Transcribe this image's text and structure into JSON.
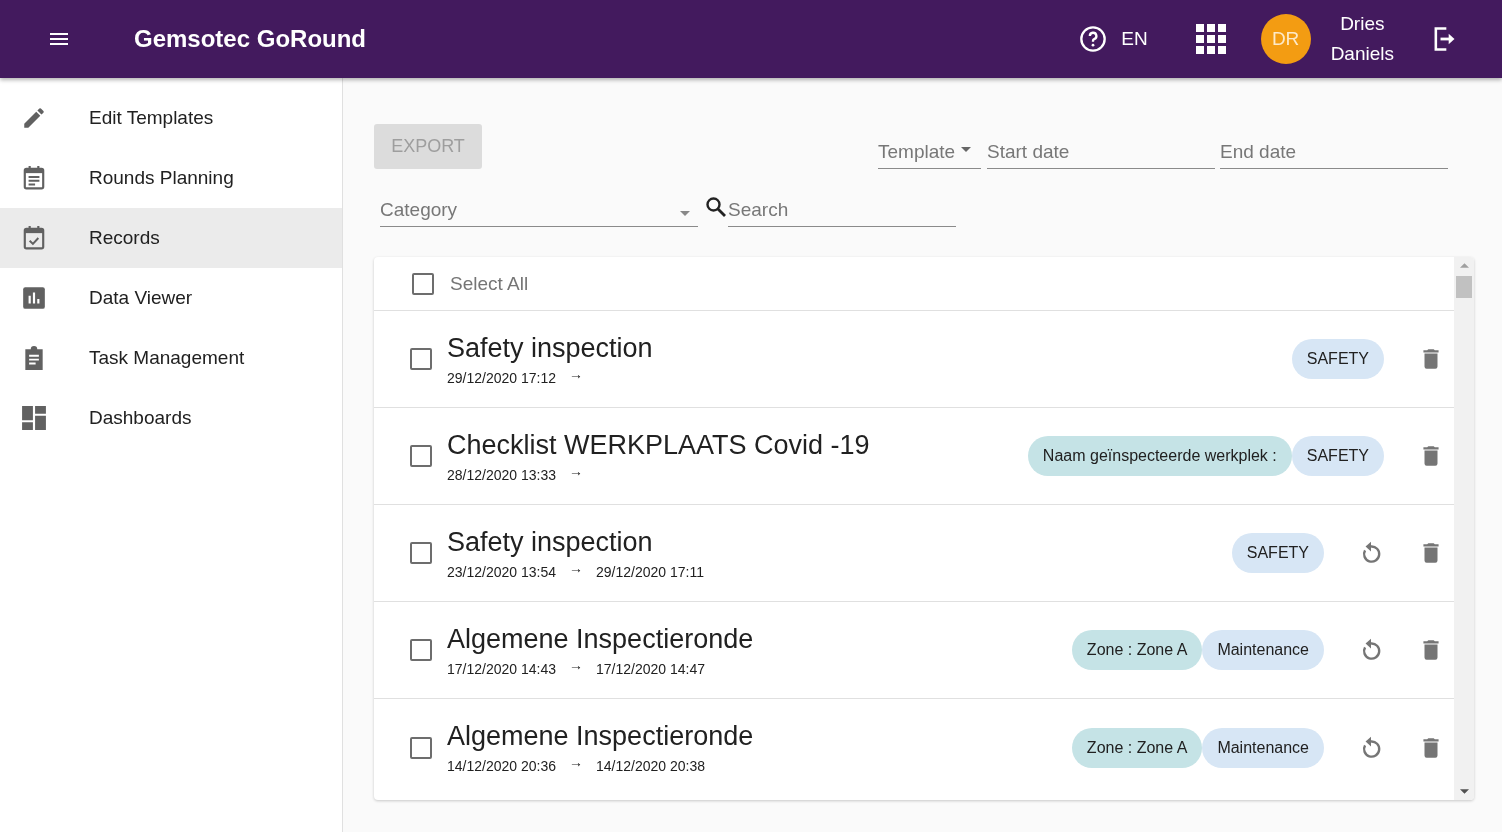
{
  "app_bar": {
    "title": "Gemsotec GoRound",
    "language": "EN",
    "avatar_initials": "DR",
    "user_name_first": "Dries",
    "user_name_last": "Daniels"
  },
  "sidebar": {
    "items": [
      {
        "label": "Edit Templates",
        "kind": "pencil",
        "selected": false
      },
      {
        "label": "Rounds Planning",
        "kind": "calendar",
        "selected": false
      },
      {
        "label": "Records",
        "kind": "check",
        "selected": true
      },
      {
        "label": "Data Viewer",
        "kind": "chart",
        "selected": false
      },
      {
        "label": "Task Management",
        "kind": "clipboard",
        "selected": false
      },
      {
        "label": "Dashboards",
        "kind": "dashboard",
        "selected": false
      }
    ]
  },
  "toolbar": {
    "export_button": {
      "label": "EXPORT",
      "disabled": true
    },
    "template_select": {
      "placeholder": "Template"
    },
    "start_date": {
      "placeholder": "Start date"
    },
    "end_date": {
      "placeholder": "End date"
    },
    "category_select": {
      "placeholder": "Category"
    },
    "search": {
      "placeholder": "Search"
    }
  },
  "records": {
    "select_all": {
      "label": "Select All",
      "checked": false
    },
    "rows": [
      {
        "title": "Safety inspection",
        "start": "29/12/2020 17:12",
        "arrow": "→",
        "end": "",
        "checked": false,
        "reopen": false,
        "tags": [
          {
            "label": "SAFETY",
            "color": "#d7e6f5"
          }
        ]
      },
      {
        "title": "Checklist WERKPLAATS Covid -19",
        "start": "28/12/2020 13:33",
        "arrow": "→",
        "end": "",
        "checked": false,
        "reopen": false,
        "tags": [
          {
            "label": "Naam geïnspecteerde werkplek :",
            "color": "#c5e3e6"
          },
          {
            "label": "SAFETY",
            "color": "#d7e6f5"
          }
        ]
      },
      {
        "title": "Safety inspection",
        "start": "23/12/2020 13:54",
        "arrow": "→",
        "end": "29/12/2020 17:11",
        "checked": false,
        "reopen": true,
        "tags": [
          {
            "label": "SAFETY",
            "color": "#d7e6f5"
          }
        ]
      },
      {
        "title": "Algemene Inspectieronde",
        "start": "17/12/2020 14:43",
        "arrow": "→",
        "end": "17/12/2020 14:47",
        "checked": false,
        "reopen": true,
        "tags": [
          {
            "label": "Zone : Zone A",
            "color": "#c5e3e6"
          },
          {
            "label": "Maintenance",
            "color": "#d7e6f5"
          }
        ]
      },
      {
        "title": "Algemene Inspectieronde",
        "start": "14/12/2020 20:36",
        "arrow": "→",
        "end": "14/12/2020 20:38",
        "checked": false,
        "reopen": true,
        "tags": [
          {
            "label": "Zone : Zone A",
            "color": "#c5e3e6"
          },
          {
            "label": "Maintenance",
            "color": "#d7e6f5"
          }
        ]
      }
    ]
  }
}
